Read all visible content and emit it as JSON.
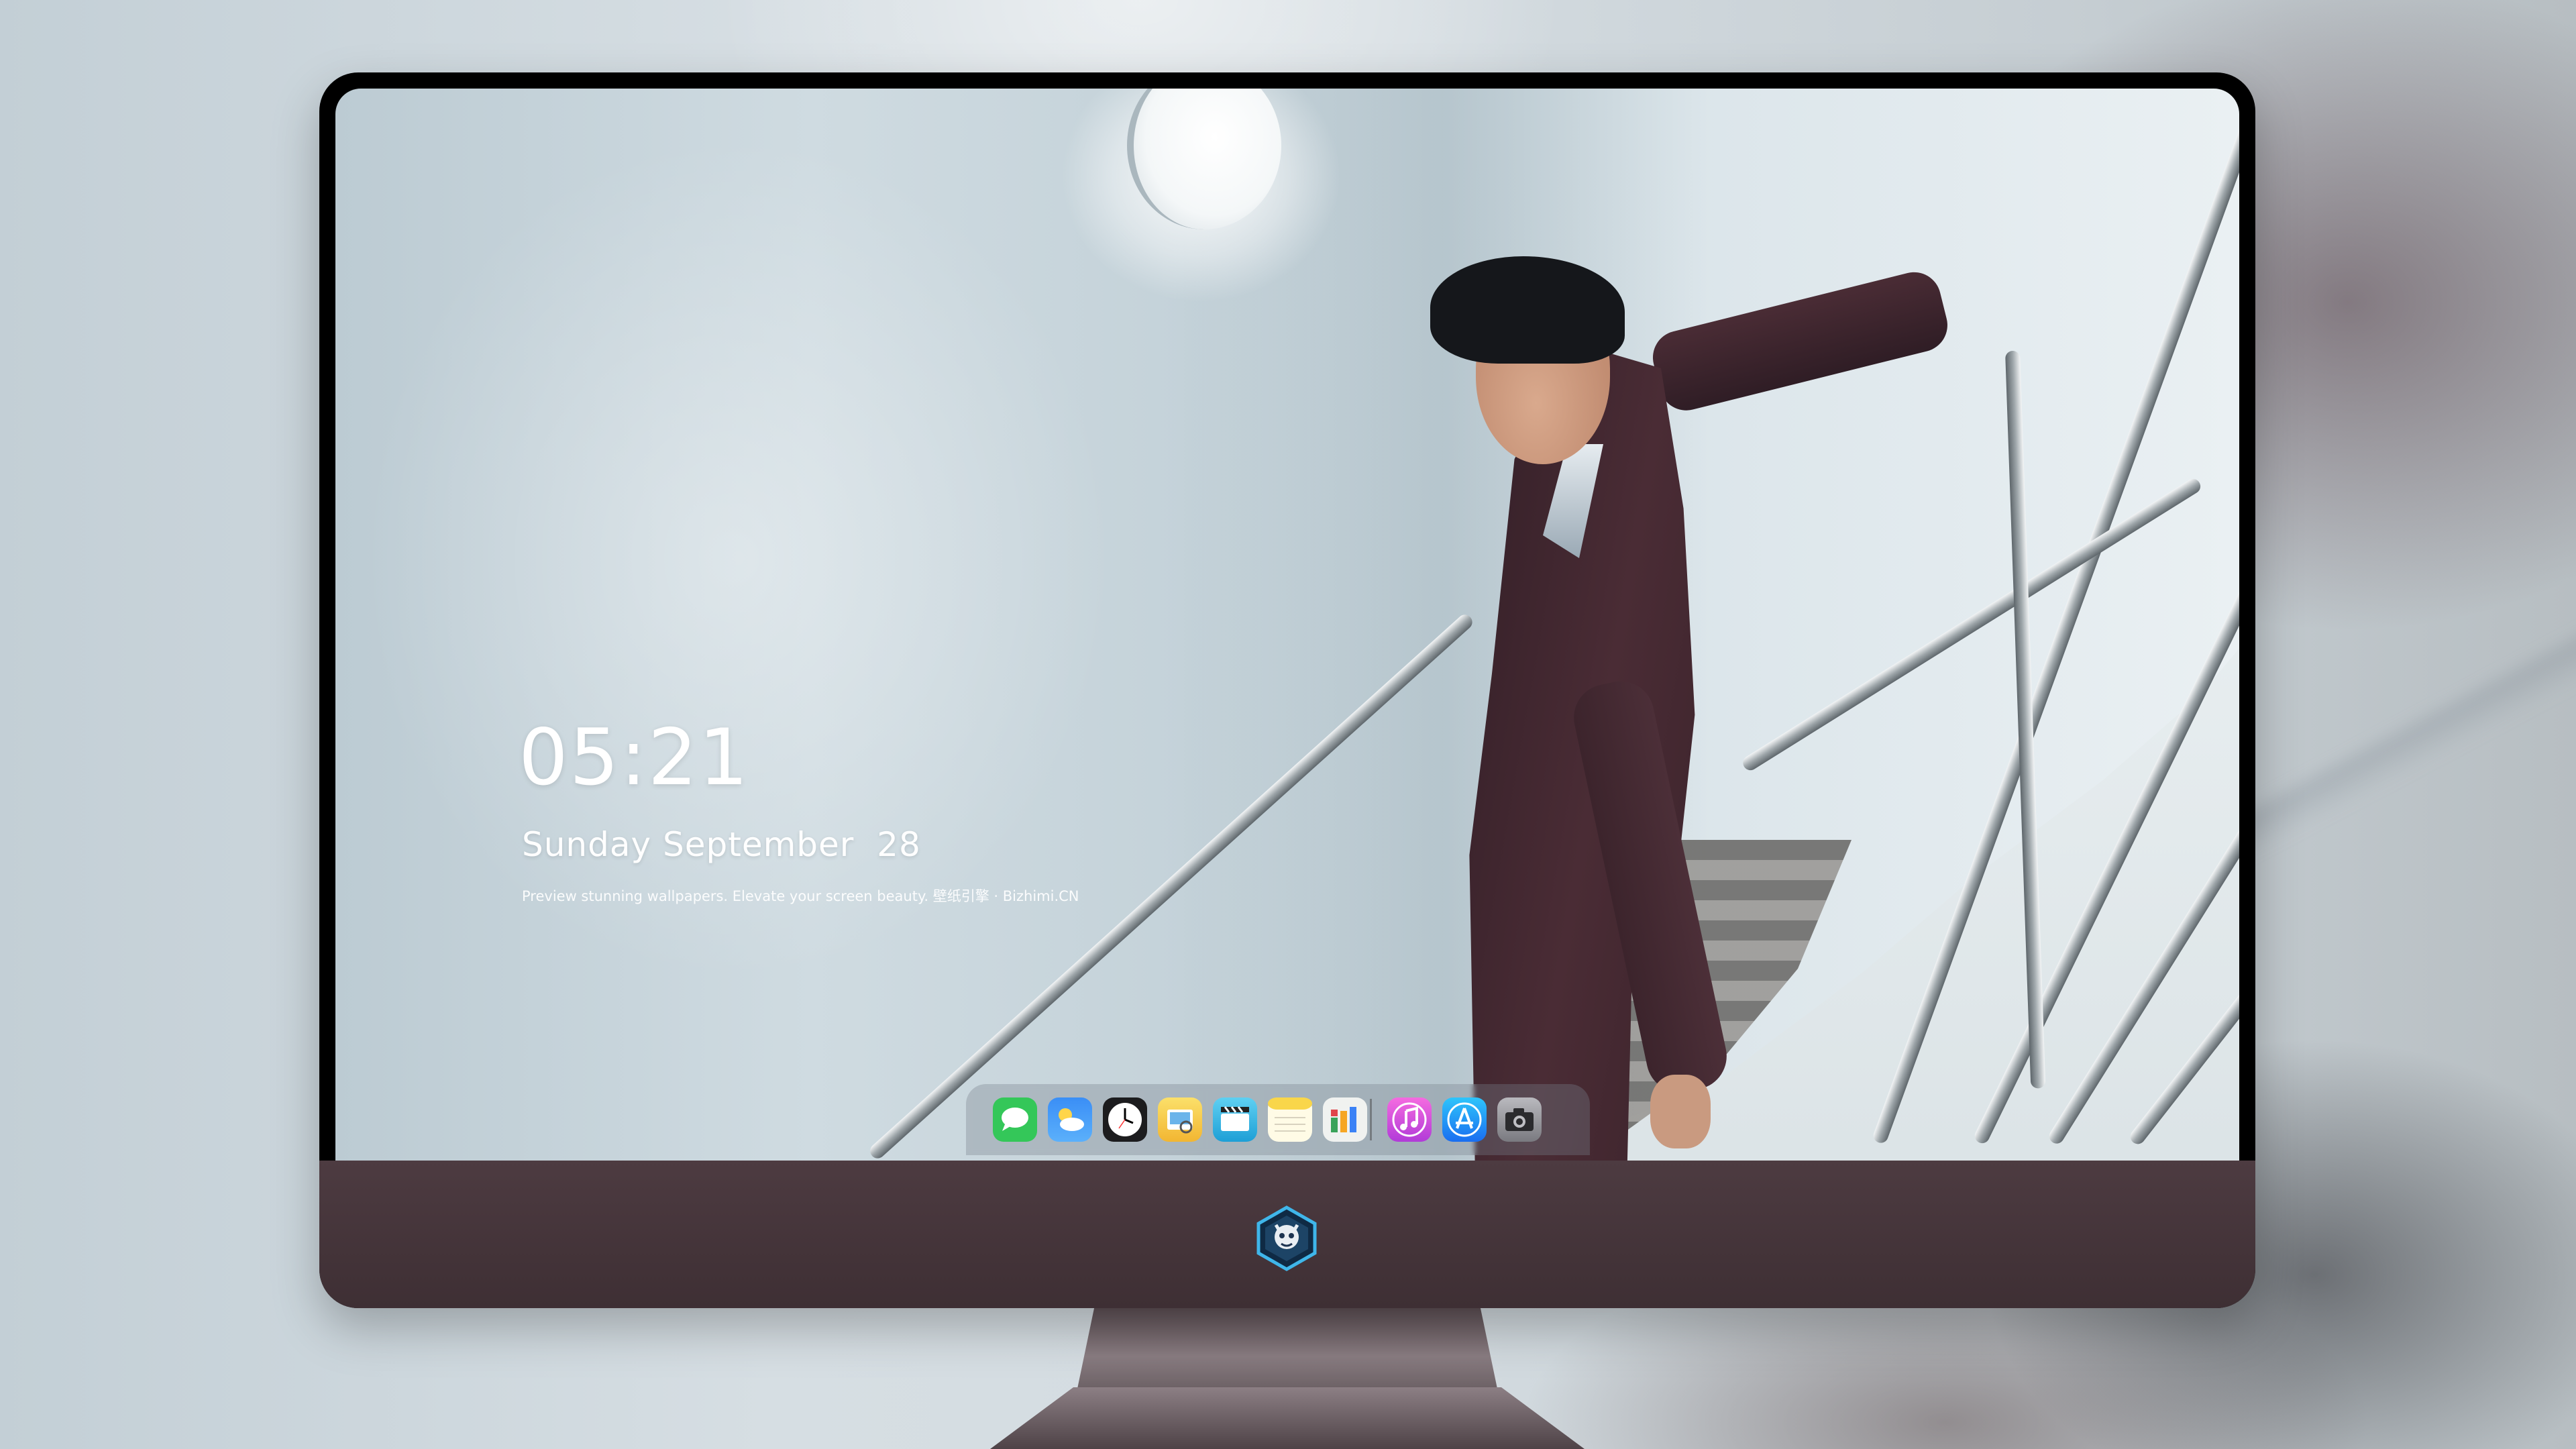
{
  "lock_screen": {
    "time": "05:21",
    "date": "Sunday September  28",
    "tagline": "Preview stunning wallpapers. Elevate your screen beauty. 壁纸引擎 · Bizhimi.CN"
  },
  "dock": {
    "apps": [
      {
        "name": "Messages",
        "icon": "messages-icon",
        "color": "#34c759"
      },
      {
        "name": "Weather",
        "icon": "weather-icon",
        "color": "#3a8ef6"
      },
      {
        "name": "Clock",
        "icon": "clock-icon",
        "color": "#1c1c1e"
      },
      {
        "name": "Preview",
        "icon": "preview-icon",
        "color": "#f5c23e"
      },
      {
        "name": "Clips",
        "icon": "clips-icon",
        "color": "#35b8e6"
      },
      {
        "name": "Notes",
        "icon": "notes-icon",
        "color": "#f9d64a"
      },
      {
        "name": "Numbers",
        "icon": "numbers-icon",
        "color": "#3aa35a"
      },
      {
        "name": "iTunes",
        "icon": "music-icon",
        "color": "#e352c8"
      },
      {
        "name": "App Store",
        "icon": "app-store-icon",
        "color": "#1d8ef5"
      },
      {
        "name": "Camera",
        "icon": "camera-icon",
        "color": "#8e8e93"
      }
    ]
  },
  "colors": {
    "bezel_chin": "#4d3b41",
    "screen_bg": "#cfdbe1",
    "logo_blue": "#3fb6ea"
  }
}
